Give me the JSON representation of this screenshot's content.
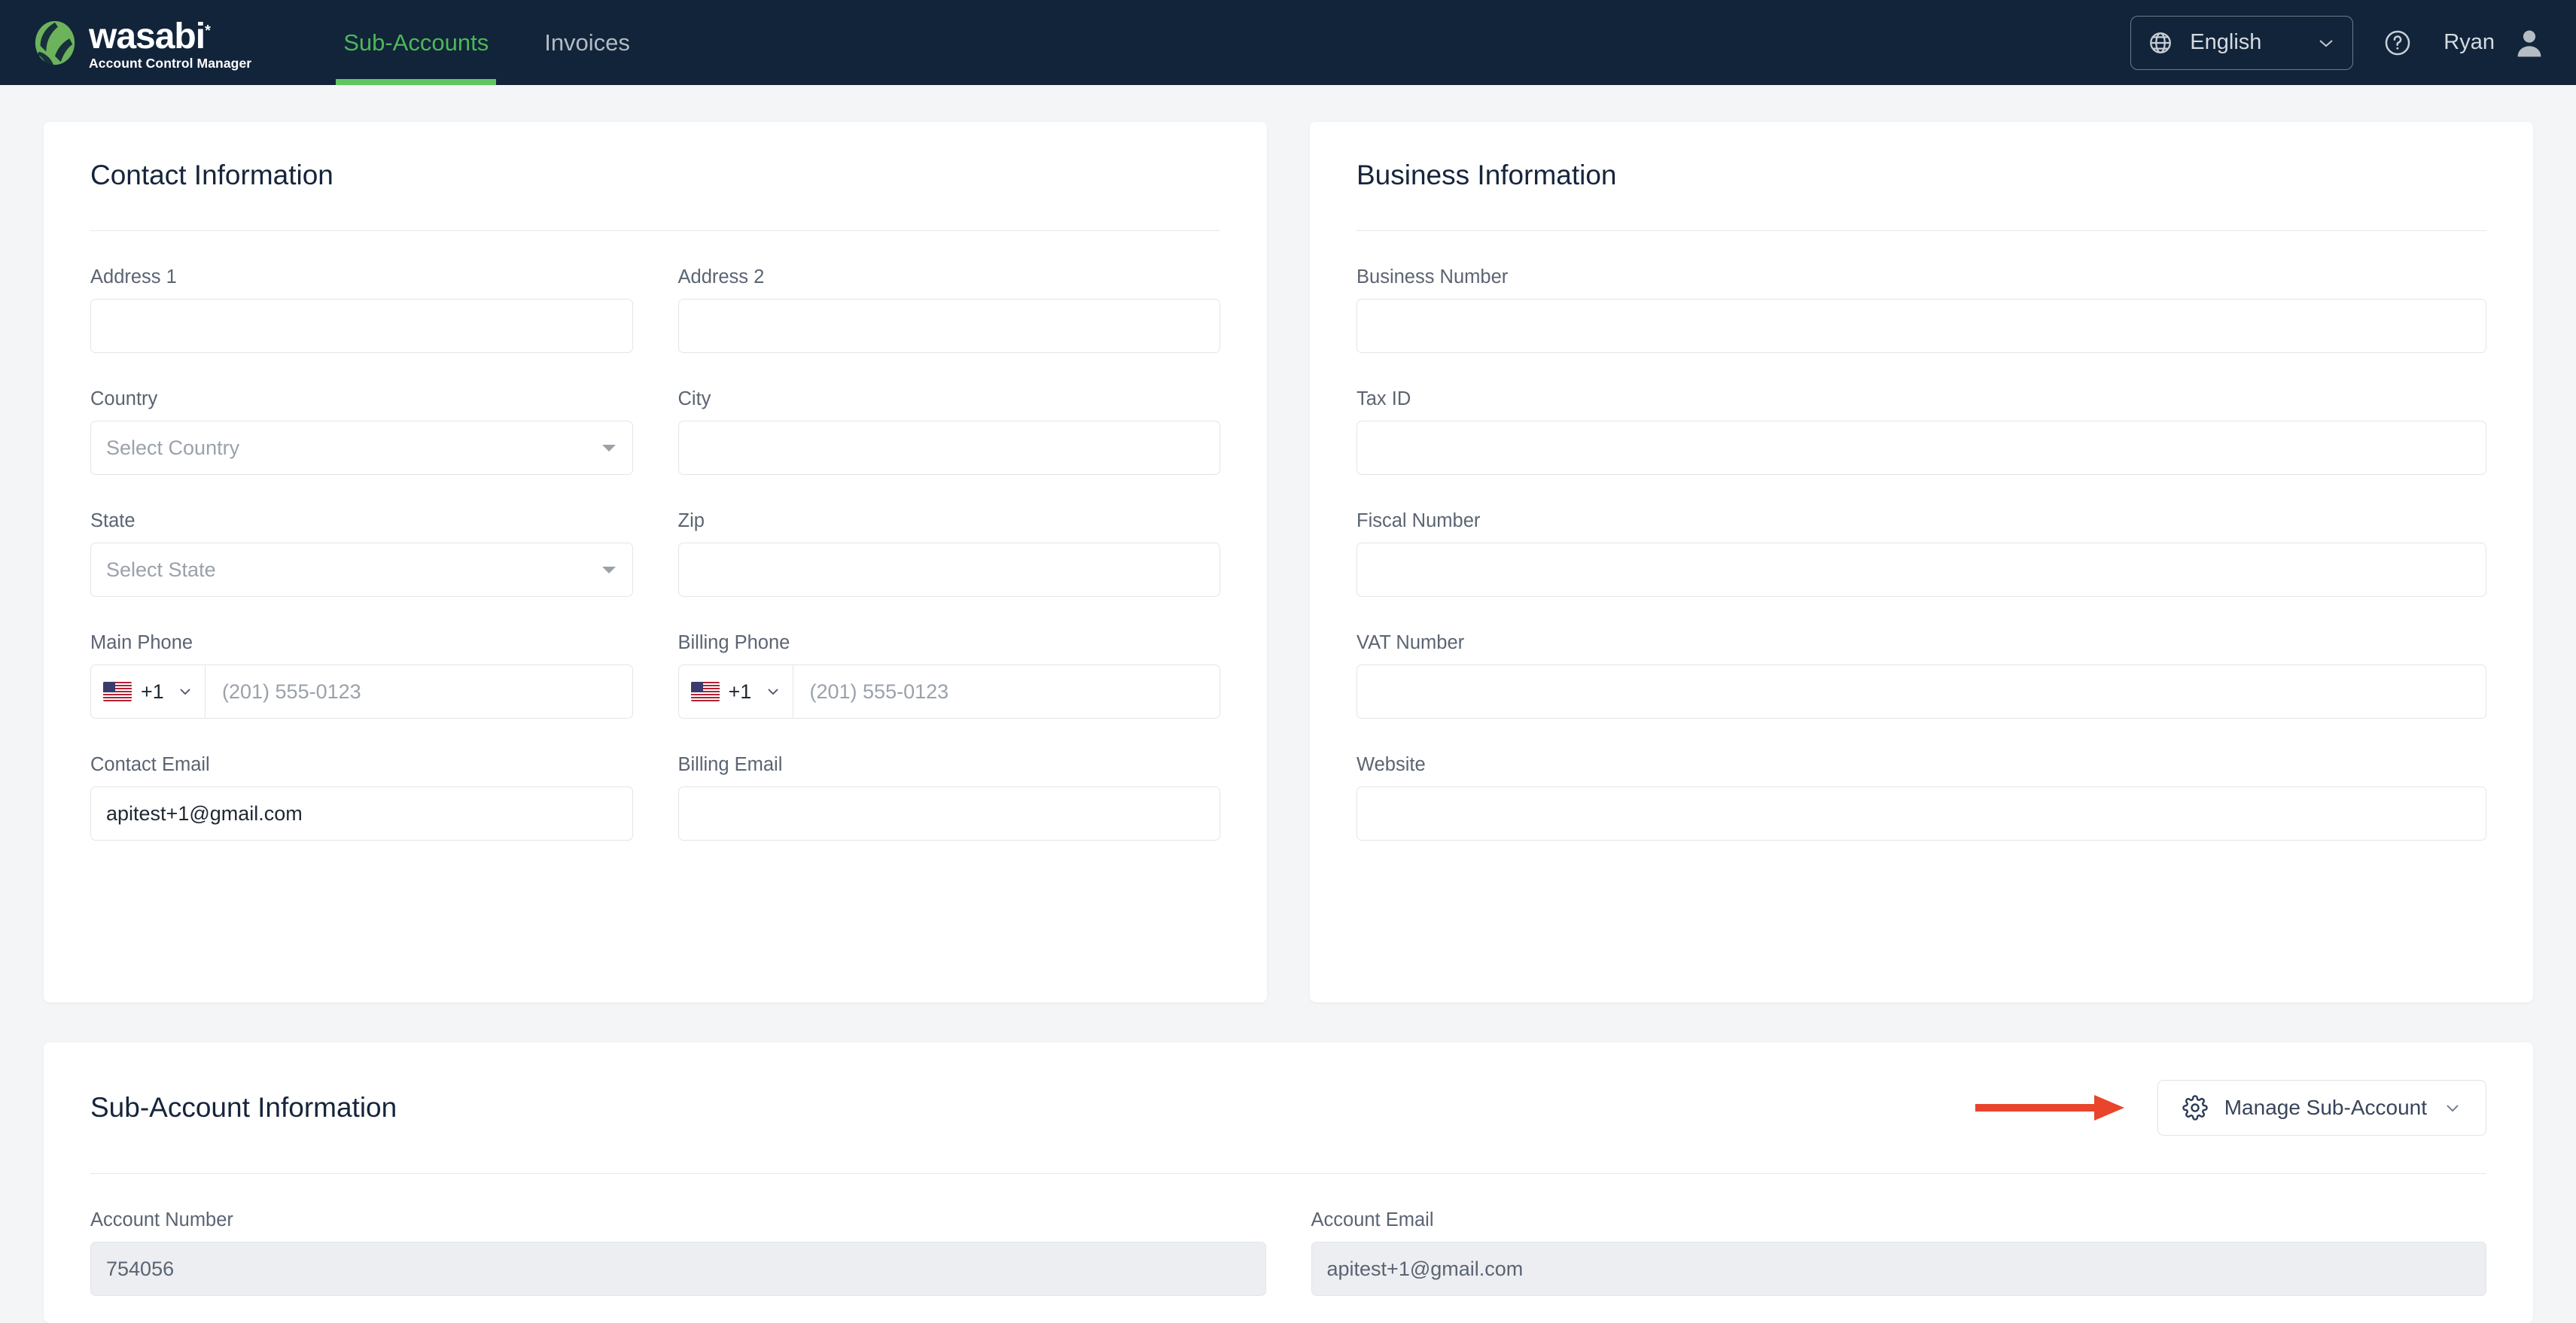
{
  "topnav": {
    "logo": {
      "word": "wasabi",
      "star": "*",
      "subtitle": "Account Control Manager"
    },
    "tabs": [
      {
        "label": "Sub-Accounts",
        "active": true
      },
      {
        "label": "Invoices",
        "active": false
      }
    ],
    "language": {
      "label": "English",
      "caret": "chevron-down",
      "icon": "globe-icon"
    },
    "help": {
      "icon": "question-circle-icon"
    },
    "user": {
      "name": "Ryan",
      "icon": "avatar-icon"
    }
  },
  "contact_card": {
    "title": "Contact Information",
    "fields": {
      "address1": {
        "label": "Address 1",
        "value": "",
        "placeholder": ""
      },
      "address2": {
        "label": "Address 2",
        "value": "",
        "placeholder": ""
      },
      "country": {
        "label": "Country",
        "value": "",
        "placeholder": "Select Country"
      },
      "city": {
        "label": "City",
        "value": "",
        "placeholder": ""
      },
      "state": {
        "label": "State",
        "value": "",
        "placeholder": "Select State"
      },
      "zip": {
        "label": "Zip",
        "value": "",
        "placeholder": ""
      },
      "main_phone": {
        "label": "Main Phone",
        "country_code": "+1",
        "flag": "us-flag",
        "placeholder": "(201) 555-0123",
        "value": ""
      },
      "billing_phone": {
        "label": "Billing Phone",
        "country_code": "+1",
        "flag": "us-flag",
        "placeholder": "(201) 555-0123",
        "value": ""
      },
      "contact_email": {
        "label": "Contact Email",
        "value": "apitest+1@gmail.com",
        "placeholder": ""
      },
      "billing_email": {
        "label": "Billing Email",
        "value": "",
        "placeholder": ""
      }
    }
  },
  "business_card": {
    "title": "Business Information",
    "fields": {
      "business_number": {
        "label": "Business Number",
        "value": "",
        "placeholder": ""
      },
      "tax_id": {
        "label": "Tax ID",
        "value": "",
        "placeholder": ""
      },
      "fiscal_number": {
        "label": "Fiscal Number",
        "value": "",
        "placeholder": ""
      },
      "vat_number": {
        "label": "VAT Number",
        "value": "",
        "placeholder": ""
      },
      "website": {
        "label": "Website",
        "value": "",
        "placeholder": ""
      }
    }
  },
  "subaccount_card": {
    "title": "Sub-Account Information",
    "manage_button": {
      "label": "Manage Sub-Account",
      "icon": "gear-icon",
      "caret": "chevron-down"
    },
    "annotation_arrow": {
      "color": "#e8452c",
      "direction": "right"
    },
    "fields": {
      "account_number": {
        "label": "Account Number",
        "value": "754056",
        "disabled": true
      },
      "account_email": {
        "label": "Account Email",
        "value": "apitest+1@gmail.com",
        "disabled": true
      }
    }
  },
  "colors": {
    "nav_background": "#11243a",
    "accent_green": "#5cc75f",
    "page_background": "#f4f5f7",
    "card_background": "#ffffff",
    "label_text": "#5b6472",
    "title_text": "#16253c",
    "annotation_red": "#e8452c"
  }
}
